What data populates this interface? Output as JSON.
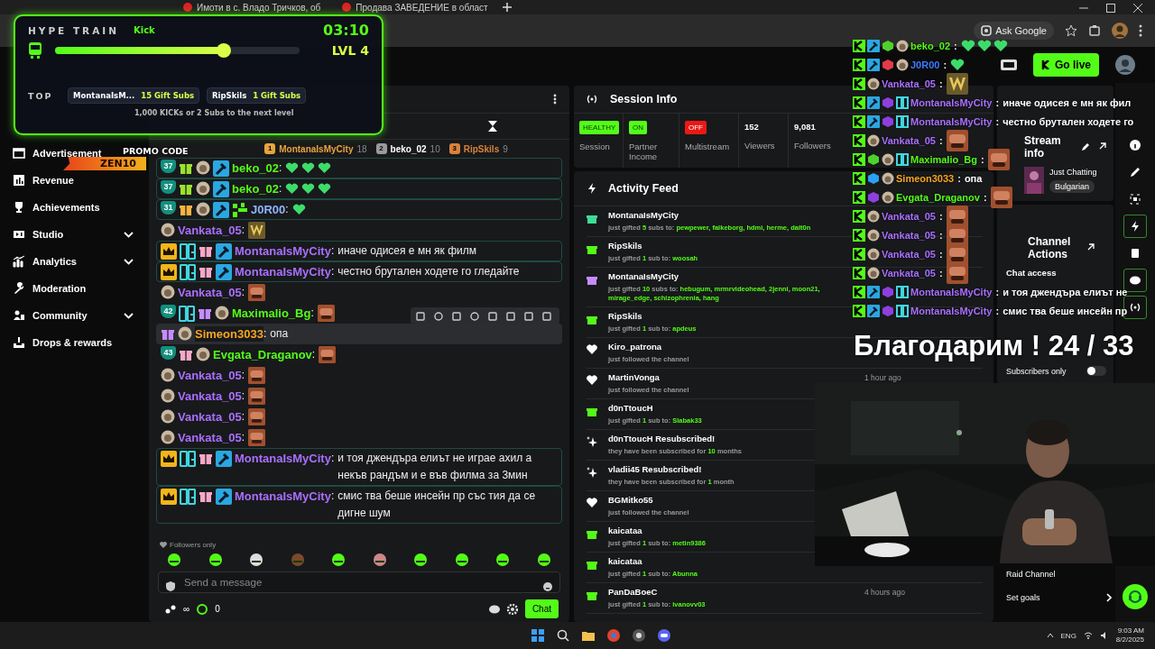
{
  "browser": {
    "tabs": [
      {
        "title": "Имоти в с. Владо Тричков, об",
        "selected": false
      },
      {
        "title": "Продава ЗАВЕДЕНИЕ в област",
        "selected": false
      }
    ],
    "ask_button": "Ask Google"
  },
  "header": {
    "go_live": "Go live"
  },
  "sidebar": {
    "items": [
      {
        "label": "Advertisement",
        "kind": "link"
      },
      {
        "label": "Revenue",
        "kind": "link"
      },
      {
        "label": "Achievements",
        "kind": "link"
      },
      {
        "label": "Studio",
        "kind": "group"
      },
      {
        "label": "Analytics",
        "kind": "group"
      },
      {
        "label": "Moderation",
        "kind": "link"
      },
      {
        "label": "Community",
        "kind": "group"
      },
      {
        "label": "Drops & rewards",
        "kind": "link"
      }
    ]
  },
  "promo": {
    "label": "PROMO CODE",
    "code": "ZEN10"
  },
  "hype_train": {
    "title": "HYPE TRAIN",
    "platform": "Kick",
    "timer": "03:10",
    "level": 0.69,
    "level_label": "LVL 4",
    "top_label": "TOP",
    "contributors": [
      {
        "name": "MontanaIsM...",
        "amount": "15 Gift Subs"
      },
      {
        "name": "RipSkils",
        "amount": "1 Gift Subs"
      }
    ],
    "footer": "1,000 KICKs or 2 Subs to the next level"
  },
  "chat": {
    "separator": ":",
    "leaderboard": [
      {
        "rank": "1",
        "name": "MontanaIsMyCity",
        "count": "18",
        "color": "#e8a33d"
      },
      {
        "rank": "2",
        "name": "beko_02",
        "count": "10",
        "color": "#9a9a9a"
      },
      {
        "rank": "3",
        "name": "RipSkils",
        "count": "9",
        "color": "#d9823b"
      }
    ],
    "messages": [
      {
        "name": "beko_02",
        "color": "#53fc18",
        "highlighted": true,
        "hovered": false,
        "badges": [
          {
            "kind": "months",
            "label": "37"
          },
          {
            "kind": "gift",
            "color": "#9be22d"
          },
          {
            "kind": "avatar"
          },
          {
            "kind": "mod"
          }
        ],
        "emotes": [
          {
            "kind": "heart"
          },
          {
            "kind": "heart"
          },
          {
            "kind": "heart"
          }
        ]
      },
      {
        "name": "beko_02",
        "color": "#53fc18",
        "highlighted": true,
        "hovered": false,
        "badges": [
          {
            "kind": "months",
            "label": "37"
          },
          {
            "kind": "gift",
            "color": "#9be22d"
          },
          {
            "kind": "avatar"
          },
          {
            "kind": "mod"
          }
        ],
        "emotes": [
          {
            "kind": "heart"
          },
          {
            "kind": "heart"
          },
          {
            "kind": "heart"
          }
        ]
      },
      {
        "name": "J0R00",
        "color": "#8fb4ff",
        "highlighted": true,
        "hovered": false,
        "badges": [
          {
            "kind": "months",
            "label": "31"
          },
          {
            "kind": "gift",
            "color": "#f5b342"
          },
          {
            "kind": "avatar"
          },
          {
            "kind": "mod"
          },
          {
            "kind": "blocks"
          }
        ],
        "emotes": [
          {
            "kind": "heart"
          }
        ]
      },
      {
        "name": "Vankata_05",
        "color": "#a970ff",
        "highlighted": false,
        "hovered": false,
        "badges": [
          {
            "kind": "avatar"
          }
        ],
        "emotes": [
          {
            "kind": "trophy"
          }
        ]
      },
      {
        "name": "MontanaIsMyCity",
        "color": "#a970ff",
        "highlighted": true,
        "hovered": false,
        "badges": [
          {
            "kind": "crown"
          },
          {
            "kind": "og"
          },
          {
            "kind": "gift",
            "color": "#f7a8c8"
          },
          {
            "kind": "mod"
          }
        ],
        "text": "иначе одисея е мн як филм"
      },
      {
        "name": "MontanaIsMyCity",
        "color": "#a970ff",
        "highlighted": true,
        "hovered": false,
        "badges": [
          {
            "kind": "crown"
          },
          {
            "kind": "og"
          },
          {
            "kind": "gift",
            "color": "#f7a8c8"
          },
          {
            "kind": "mod"
          }
        ],
        "text": "честно брутален ходете го гледайте"
      },
      {
        "name": "Vankata_05",
        "color": "#a970ff",
        "highlighted": false,
        "hovered": false,
        "badges": [
          {
            "kind": "avatar"
          }
        ],
        "emotes": [
          {
            "kind": "sticker"
          }
        ]
      },
      {
        "name": "Maximalio_Bg",
        "color": "#53fc18",
        "highlighted": false,
        "hovered": false,
        "badges": [
          {
            "kind": "months",
            "label": "42"
          },
          {
            "kind": "og"
          },
          {
            "kind": "gift",
            "color": "#c58cff"
          },
          {
            "kind": "avatar"
          }
        ],
        "emotes": [
          {
            "kind": "sticker"
          }
        ]
      },
      {
        "name": "Simeon3033",
        "color": "#f5a623",
        "highlighted": false,
        "hovered": true,
        "badges": [
          {
            "kind": "gift",
            "color": "#c58cff"
          },
          {
            "kind": "avatar"
          }
        ],
        "text": "опа"
      },
      {
        "name": "Evgata_Draganov",
        "color": "#53fc18",
        "highlighted": false,
        "hovered": false,
        "badges": [
          {
            "kind": "months",
            "label": "43"
          },
          {
            "kind": "gift",
            "color": "#f7a8c8"
          },
          {
            "kind": "avatar"
          }
        ],
        "emotes": [
          {
            "kind": "sticker"
          }
        ]
      },
      {
        "name": "Vankata_05",
        "color": "#a970ff",
        "highlighted": false,
        "hovered": false,
        "badges": [
          {
            "kind": "avatar"
          }
        ],
        "emotes": [
          {
            "kind": "sticker"
          }
        ]
      },
      {
        "name": "Vankata_05",
        "color": "#a970ff",
        "highlighted": false,
        "hovered": false,
        "badges": [
          {
            "kind": "avatar"
          }
        ],
        "emotes": [
          {
            "kind": "sticker"
          }
        ]
      },
      {
        "name": "Vankata_05",
        "color": "#a970ff",
        "highlighted": false,
        "hovered": false,
        "badges": [
          {
            "kind": "avatar"
          }
        ],
        "emotes": [
          {
            "kind": "sticker"
          }
        ]
      },
      {
        "name": "Vankata_05",
        "color": "#a970ff",
        "highlighted": false,
        "hovered": false,
        "badges": [
          {
            "kind": "avatar"
          }
        ],
        "emotes": [
          {
            "kind": "sticker"
          }
        ]
      },
      {
        "name": "MontanaIsMyCity",
        "color": "#a970ff",
        "highlighted": true,
        "hovered": false,
        "badges": [
          {
            "kind": "crown"
          },
          {
            "kind": "og"
          },
          {
            "kind": "gift",
            "color": "#f7a8c8"
          },
          {
            "kind": "mod"
          }
        ],
        "text": "и тоя джендъра елиът не играе ахил а некъв рандъм и е във филма за 3мин"
      },
      {
        "name": "MontanaIsMyCity",
        "color": "#a970ff",
        "highlighted": true,
        "hovered": false,
        "badges": [
          {
            "kind": "crown"
          },
          {
            "kind": "og"
          },
          {
            "kind": "gift",
            "color": "#f7a8c8"
          },
          {
            "kind": "mod"
          }
        ],
        "text": "смис тва беше инсейн пр със тия да се дигне шум"
      }
    ],
    "mode": "Followers only",
    "placeholder": "Send a message",
    "limit": "∞",
    "points": "0",
    "send": "Chat"
  },
  "session_info": {
    "title": "Session Info",
    "stats": [
      {
        "kind": "status",
        "value": "HEALTHY",
        "label": "Session",
        "color": "#53fc18"
      },
      {
        "kind": "status",
        "value": "ON",
        "label": "Partner Income",
        "color": "#53fc18"
      },
      {
        "kind": "status",
        "value": "OFF",
        "label": "Multistream",
        "color": "#e91916"
      },
      {
        "kind": "number",
        "value": "152",
        "label": "Viewers"
      },
      {
        "kind": "number",
        "value": "9,081",
        "label": "Followers"
      }
    ]
  },
  "activity_feed": {
    "title": "Activity Feed",
    "items": [
      {
        "kind": "gift",
        "color": "#3ddc97",
        "user": "MontanaIsMyCity",
        "action": "just gifted",
        "count": "5",
        "unit": "subs to:",
        "recipients": "pewpewer, falkeborg, hdmi, herme, dalt0n"
      },
      {
        "kind": "gift",
        "color": "#53fc18",
        "user": "RipSkils",
        "action": "just gifted",
        "count": "1",
        "unit": "sub to:",
        "recipients": "woosah"
      },
      {
        "kind": "gift",
        "color": "#c58cff",
        "user": "MontanaIsMyCity",
        "action": "just gifted",
        "count": "10",
        "unit": "subs to:",
        "recipients": "hebugum, mrmrvideohead, 2jenni, moon21, mirage_edge, schizophrenia, hang"
      },
      {
        "kind": "gift",
        "color": "#53fc18",
        "user": "RipSkils",
        "action": "just gifted",
        "count": "1",
        "unit": "sub to:",
        "recipients": "apdeus"
      },
      {
        "kind": "follow",
        "user": "Kiro_patrona",
        "action": "just followed the channel"
      },
      {
        "kind": "follow",
        "user": "MartinVonga",
        "action": "just followed the channel",
        "time": "1 hour ago"
      },
      {
        "kind": "gift",
        "color": "#53fc18",
        "user": "d0nTtoucH",
        "action": "just gifted",
        "count": "1",
        "unit": "sub to:",
        "recipients": "Slabak33"
      },
      {
        "kind": "resub",
        "user": "d0nTtoucH Resubscribed!",
        "action": "they have been subscribed for",
        "count": "10",
        "unit": "months"
      },
      {
        "kind": "resub",
        "user": "vladii45 Resubscribed!",
        "action": "they have been subscribed for",
        "count": "1",
        "unit": "month"
      },
      {
        "kind": "follow",
        "user": "BGMitko55",
        "action": "just followed the channel"
      },
      {
        "kind": "gift",
        "color": "#53fc18",
        "user": "kaicataa",
        "action": "just gifted",
        "count": "1",
        "unit": "sub to:",
        "recipients": "metin9386"
      },
      {
        "kind": "gift",
        "color": "#53fc18",
        "user": "kaicataa",
        "action": "just gifted",
        "count": "1",
        "unit": "sub to:",
        "recipients": "Abunna"
      },
      {
        "kind": "gift",
        "color": "#53fc18",
        "user": "PanDaBoeC",
        "action": "just gifted",
        "count": "1",
        "unit": "sub to:",
        "recipients": "ivanovv03",
        "time": "4 hours ago"
      }
    ]
  },
  "stream_info": {
    "title": "Stream info",
    "category": "Just Chatting",
    "tag": "Bulgarian"
  },
  "channel_actions": {
    "title": "Channel Actions",
    "section": "Chat access",
    "toggles": [
      {
        "label": "Subscribers only",
        "on": false
      }
    ],
    "links": [
      {
        "label": "Raid Channel",
        "kind": "plain"
      },
      {
        "label": "Set goals",
        "kind": "nav"
      }
    ]
  },
  "stream_overlay": {
    "separator": ":",
    "lines": [
      {
        "name": "beko_02",
        "color": "#53fc18",
        "badges": [
          {
            "kind": "kick"
          },
          {
            "kind": "mod"
          },
          {
            "kind": "cube-green"
          },
          {
            "kind": "avatar"
          }
        ],
        "emotes": [
          {
            "kind": "heart"
          },
          {
            "kind": "heart"
          },
          {
            "kind": "heart"
          }
        ]
      },
      {
        "name": "J0R00",
        "color": "#3d7bff",
        "badges": [
          {
            "kind": "kick"
          },
          {
            "kind": "mod"
          },
          {
            "kind": "cube-red"
          },
          {
            "kind": "avatar"
          }
        ],
        "emotes": [
          {
            "kind": "heart"
          }
        ]
      },
      {
        "name": "Vankata_05",
        "color": "#a970ff",
        "badges": [
          {
            "kind": "kick"
          },
          {
            "kind": "avatar"
          }
        ],
        "emotes": [
          {
            "kind": "trophy"
          }
        ]
      },
      {
        "name": "MontanaIsMyCity",
        "color": "#a970ff",
        "badges": [
          {
            "kind": "kick"
          },
          {
            "kind": "mod"
          },
          {
            "kind": "cube-purple"
          },
          {
            "kind": "og"
          }
        ],
        "text": "иначе одисея е мн як фил"
      },
      {
        "name": "MontanaIsMyCity",
        "color": "#a970ff",
        "badges": [
          {
            "kind": "kick"
          },
          {
            "kind": "mod"
          },
          {
            "kind": "cube-purple"
          },
          {
            "kind": "og"
          }
        ],
        "text": "честно брутален ходете го"
      },
      {
        "name": "Vankata_05",
        "color": "#a970ff",
        "badges": [
          {
            "kind": "kick"
          },
          {
            "kind": "avatar"
          }
        ],
        "emotes": [
          {
            "kind": "sticker"
          }
        ]
      },
      {
        "name": "Maximalio_Bg",
        "color": "#53fc18",
        "badges": [
          {
            "kind": "kick"
          },
          {
            "kind": "cube-green"
          },
          {
            "kind": "avatar"
          },
          {
            "kind": "og"
          }
        ],
        "emotes": [
          {
            "kind": "sticker"
          }
        ]
      },
      {
        "name": "Simeon3033",
        "color": "#f5a623",
        "badges": [
          {
            "kind": "kick"
          },
          {
            "kind": "cube-blue"
          },
          {
            "kind": "avatar"
          }
        ],
        "text": "опа"
      },
      {
        "name": "Evgata_Draganov",
        "color": "#53fc18",
        "badges": [
          {
            "kind": "kick"
          },
          {
            "kind": "cube-purple"
          },
          {
            "kind": "avatar"
          }
        ],
        "emotes": [
          {
            "kind": "sticker"
          }
        ]
      },
      {
        "name": "Vankata_05",
        "color": "#a970ff",
        "badges": [
          {
            "kind": "kick"
          },
          {
            "kind": "avatar"
          }
        ],
        "emotes": [
          {
            "kind": "sticker"
          }
        ]
      },
      {
        "name": "Vankata_05",
        "color": "#a970ff",
        "badges": [
          {
            "kind": "kick"
          },
          {
            "kind": "avatar"
          }
        ],
        "emotes": [
          {
            "kind": "sticker"
          }
        ]
      },
      {
        "name": "Vankata_05",
        "color": "#a970ff",
        "badges": [
          {
            "kind": "kick"
          },
          {
            "kind": "avatar"
          }
        ],
        "emotes": [
          {
            "kind": "sticker"
          }
        ]
      },
      {
        "name": "Vankata_05",
        "color": "#a970ff",
        "badges": [
          {
            "kind": "kick"
          },
          {
            "kind": "avatar"
          }
        ],
        "emotes": [
          {
            "kind": "sticker"
          }
        ]
      },
      {
        "name": "MontanaIsMyCity",
        "color": "#a970ff",
        "badges": [
          {
            "kind": "kick"
          },
          {
            "kind": "mod"
          },
          {
            "kind": "cube-purple"
          },
          {
            "kind": "og"
          }
        ],
        "text": "и тоя джендъра елиът не"
      },
      {
        "name": "MontanaIsMyCity",
        "color": "#a970ff",
        "badges": [
          {
            "kind": "kick"
          },
          {
            "kind": "mod"
          },
          {
            "kind": "cube-purple"
          },
          {
            "kind": "og"
          }
        ],
        "text": "смис тва беше инсейн пр"
      }
    ],
    "thanks": "Благодарим ! 24 / 33"
  },
  "taskbar": {
    "language": "ENG",
    "time": "9:03 AM",
    "date": "8/2/2025"
  }
}
